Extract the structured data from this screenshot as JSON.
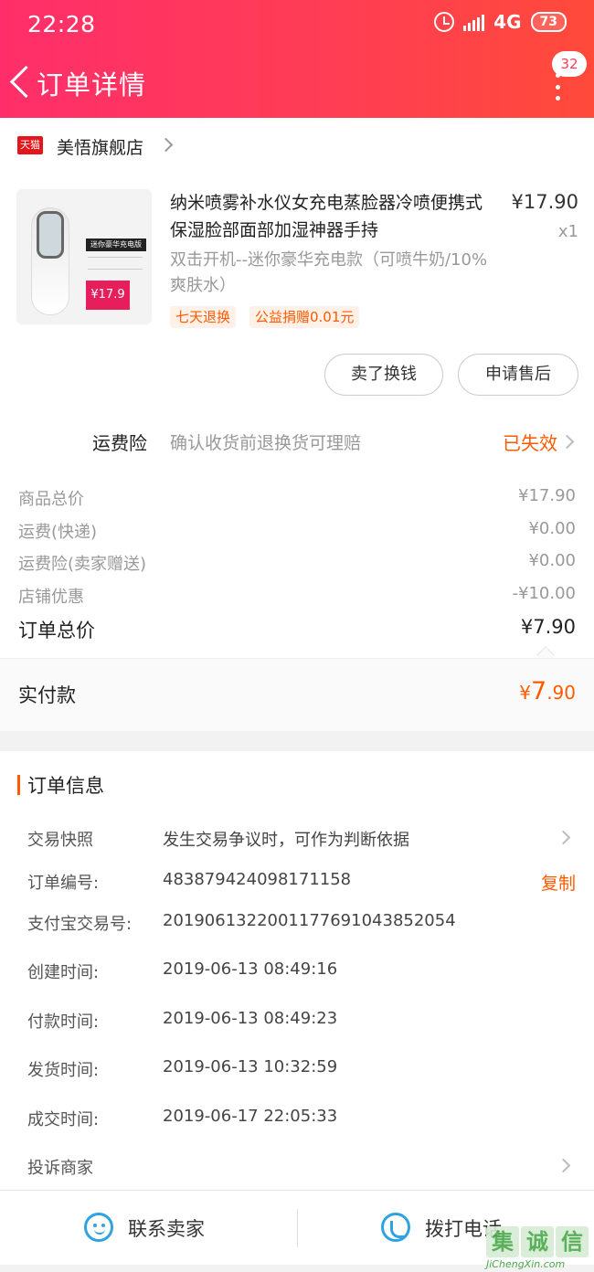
{
  "status_bar": {
    "time": "22:28",
    "network": "4G",
    "battery": "73"
  },
  "header": {
    "title": "订单详情",
    "badge": "32"
  },
  "shop": {
    "logo": "天猫",
    "name": "美悟旗舰店"
  },
  "item": {
    "thumb_tag": "迷你豪华充电版",
    "thumb_price": "¥17.9",
    "title": "纳米喷雾补水仪女充电蒸脸器冷喷便携式保湿脸部面部加湿神器手持",
    "price": "¥17.90",
    "qty": "x1",
    "spec": "双击开机--迷你豪华充电款（可喷牛奶/10%爽肤水）",
    "chips": [
      "七天退换",
      "公益捐赠0.01元"
    ],
    "buttons": [
      "卖了换钱",
      "申请售后"
    ]
  },
  "insurance": {
    "label": "运费险",
    "desc": "确认收货前退换货可理赔",
    "status": "已失效"
  },
  "prices": {
    "lines": [
      {
        "label": "商品总价",
        "value": "¥17.90"
      },
      {
        "label": "运费(快递)",
        "value": "¥0.00"
      },
      {
        "label": "运费险(卖家赠送)",
        "value": "¥0.00"
      },
      {
        "label": "店铺优惠",
        "value": "-¥10.00"
      }
    ],
    "total_label": "订单总价",
    "total_value": "¥7.90",
    "paid_label": "实付款",
    "paid_symbol": "¥",
    "paid_int": "7",
    "paid_dec": ".90"
  },
  "order_info": {
    "title": "订单信息",
    "snapshot_label": "交易快照",
    "snapshot_desc": "发生交易争议时，可作为判断依据",
    "order_no_label": "订单编号:",
    "order_no": "483879424098171158",
    "copy_label": "复制",
    "alipay_label": "支付宝交易号:",
    "alipay_no": "2019061322001177691043852054",
    "created_label": "创建时间:",
    "created": "2019-06-13 08:49:16",
    "paid_label": "付款时间:",
    "paid": "2019-06-13 08:49:23",
    "shipped_label": "发货时间:",
    "shipped": "2019-06-13 10:32:59",
    "done_label": "成交时间:",
    "done": "2019-06-17 22:05:33",
    "complain_label": "投诉商家"
  },
  "bottom": {
    "contact": "联系卖家",
    "call": "拨打电话"
  },
  "watermark": {
    "chars": [
      "集",
      "诚",
      "信"
    ],
    "url": "JiChengXin.com"
  },
  "colors": {
    "header_start": "#ff2e6a",
    "header_end": "#ff4a3a",
    "accent": "#ff5a00",
    "icon_blue": "#2ea3e0"
  }
}
